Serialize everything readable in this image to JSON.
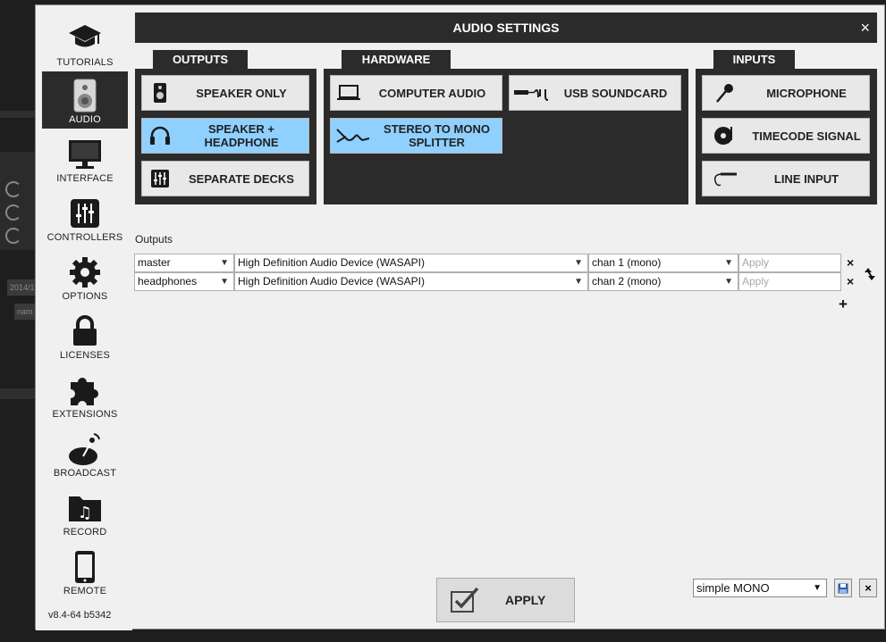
{
  "window": {
    "title": "AUDIO SETTINGS",
    "close_glyph": "×"
  },
  "background": {
    "cell_a": "2014/1",
    "cell_b": "nam"
  },
  "sidebar": {
    "items": [
      {
        "label": "TUTORIALS",
        "icon": "graduation-cap-icon"
      },
      {
        "label": "AUDIO",
        "icon": "speaker-icon",
        "active": true
      },
      {
        "label": "INTERFACE",
        "icon": "monitor-icon"
      },
      {
        "label": "CONTROLLERS",
        "icon": "sliders-icon"
      },
      {
        "label": "OPTIONS",
        "icon": "gear-icon"
      },
      {
        "label": "LICENSES",
        "icon": "lock-icon"
      },
      {
        "label": "EXTENSIONS",
        "icon": "puzzle-icon"
      },
      {
        "label": "BROADCAST",
        "icon": "satellite-dish-icon"
      },
      {
        "label": "RECORD",
        "icon": "music-folder-icon"
      },
      {
        "label": "REMOTE",
        "icon": "tablet-icon"
      }
    ],
    "version": "v8.4-64 b5342"
  },
  "outputs_panel": {
    "tab": "OUTPUTS",
    "options": [
      {
        "label": "SPEAKER ONLY",
        "icon": "speaker-icon",
        "selected": false
      },
      {
        "label": "SPEAKER + HEADPHONE",
        "line1": "SPEAKER +",
        "line2": "HEADPHONE",
        "icon": "headphones-icon",
        "selected": true
      },
      {
        "label": "SEPARATE DECKS",
        "icon": "mixer-icon",
        "selected": false
      }
    ]
  },
  "hardware_panel": {
    "tab": "HARDWARE",
    "options": [
      {
        "label": "COMPUTER AUDIO",
        "icon": "laptop-icon",
        "selected": false
      },
      {
        "label": "USB SOUNDCARD",
        "icon": "usb-soundcard-icon",
        "selected": false
      },
      {
        "label": "STEREO TO MONO SPLITTER",
        "line1": "STEREO TO MONO",
        "line2": "SPLITTER",
        "icon": "splitter-cable-icon",
        "selected": true
      }
    ]
  },
  "inputs_panel": {
    "tab": "INPUTS",
    "options": [
      {
        "label": "MICROPHONE",
        "icon": "microphone-icon",
        "selected": false
      },
      {
        "label": "TIMECODE SIGNAL",
        "icon": "vinyl-icon",
        "selected": false
      },
      {
        "label": "LINE INPUT",
        "icon": "jack-cable-icon",
        "selected": false
      }
    ]
  },
  "outputs_section": {
    "label": "Outputs",
    "rows": [
      {
        "channel": "master",
        "device": "High Definition Audio Device (WASAPI)",
        "chan": "chan 1 (mono)",
        "apply_placeholder": "Apply",
        "remove": "×"
      },
      {
        "channel": "headphones",
        "device": "High Definition Audio Device (WASAPI)",
        "chan": "chan 2 (mono)",
        "apply_placeholder": "Apply",
        "remove": "×"
      }
    ],
    "add": "+"
  },
  "footer": {
    "apply_label": "APPLY",
    "preset_value": "simple MONO",
    "delete_glyph": "×"
  },
  "colors": {
    "selected": "#8fd0ff",
    "panel": "#2b2b2b",
    "dialog": "#f0f0f0"
  }
}
